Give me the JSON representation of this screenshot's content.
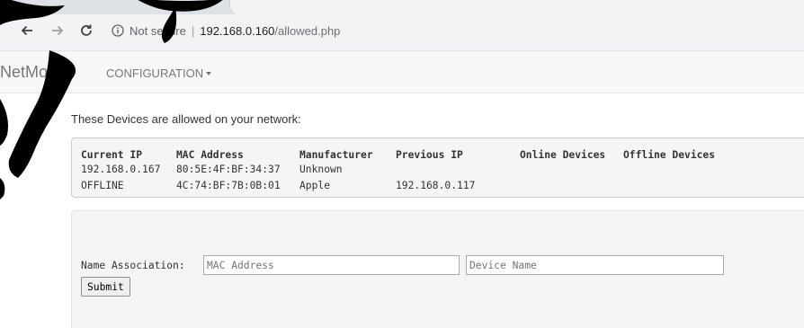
{
  "browser": {
    "security_text": "Not secure",
    "separator": "|",
    "url_host": "192.168.0.160",
    "url_path": "/allowed.php"
  },
  "navbar": {
    "brand": "NetMon",
    "menu_configuration": "CONFIGURATION"
  },
  "main": {
    "intro_text": "These Devices are allowed on your network:",
    "table": {
      "columns": [
        "Current IP",
        "MAC Address",
        "Manufacturer",
        "Previous IP",
        "Online Devices",
        "Offline Devices"
      ],
      "rows": [
        [
          "192.168.0.167",
          "80:5E:4F:BF:34:37",
          "Unknown",
          "",
          "",
          ""
        ],
        [
          "OFFLINE",
          "4C:74:BF:7B:0B:01",
          "Apple",
          "192.168.0.117",
          "",
          ""
        ]
      ]
    },
    "association": {
      "label": "Name Association:",
      "mac_placeholder": "MAC Address",
      "name_placeholder": "Device Name",
      "submit_label": "Submit"
    }
  },
  "colors": {
    "annotation_marks": "#000000",
    "navbar_bg": "#f8f8f8",
    "panel_bg": "#f5f5f5"
  }
}
